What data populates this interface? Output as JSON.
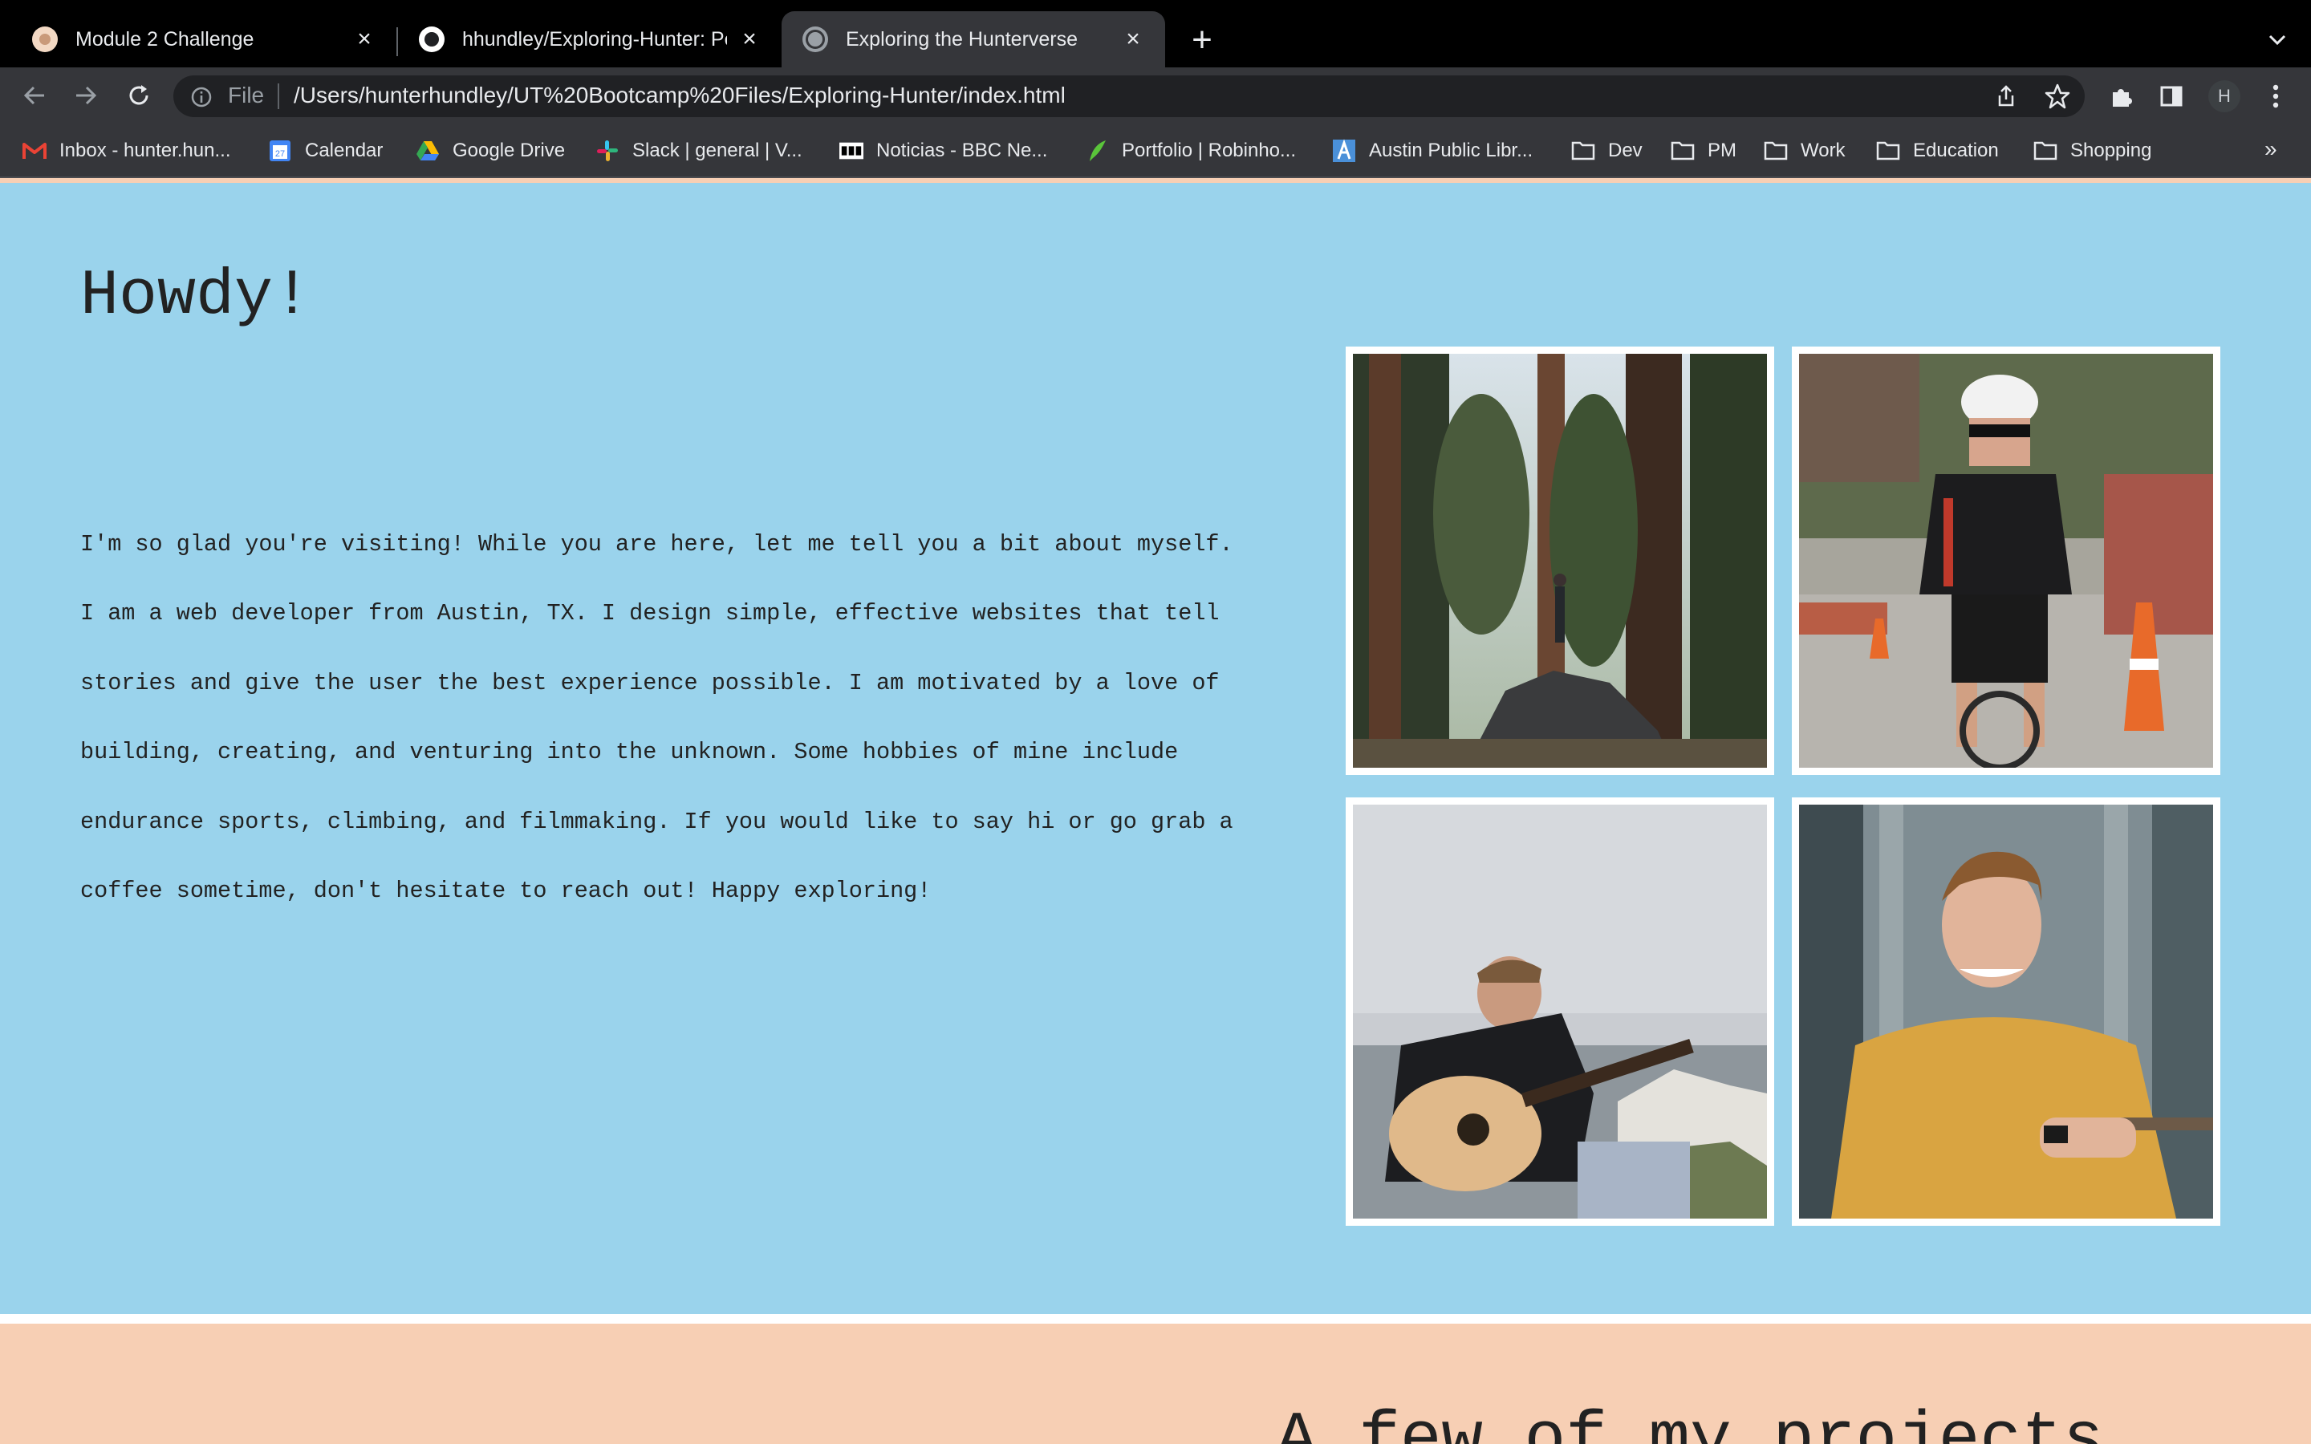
{
  "browser": {
    "tabs": [
      {
        "title": "Module 2 Challenge",
        "active": false
      },
      {
        "title": "hhundley/Exploring-Hunter: Pe",
        "active": false
      },
      {
        "title": "Exploring the Hunterverse",
        "active": true
      }
    ],
    "address": {
      "scheme_label": "File",
      "url": "/Users/hunterhundley/UT%20Bootcamp%20Files/Exploring-Hunter/index.html"
    },
    "profile_initial": "H",
    "bookmarks": [
      {
        "label": "Inbox - hunter.hun...",
        "icon": "gmail-icon"
      },
      {
        "label": "Calendar",
        "icon": "calendar-icon"
      },
      {
        "label": "Google Drive",
        "icon": "drive-icon"
      },
      {
        "label": "Slack | general | V...",
        "icon": "slack-icon"
      },
      {
        "label": "Noticias - BBC Ne...",
        "icon": "bbc-icon"
      },
      {
        "label": "Portfolio | Robinho...",
        "icon": "robinhood-icon"
      },
      {
        "label": "Austin Public Libr...",
        "icon": "library-icon"
      },
      {
        "label": "Dev",
        "icon": "folder-icon"
      },
      {
        "label": "PM",
        "icon": "folder-icon"
      },
      {
        "label": "Work",
        "icon": "folder-icon"
      },
      {
        "label": "Education",
        "icon": "folder-icon"
      },
      {
        "label": "Shopping",
        "icon": "folder-icon"
      }
    ],
    "overflow_label": "»"
  },
  "page": {
    "greeting": "Howdy!",
    "intro": "I'm so glad you're visiting! While you are here, let me tell you a bit about myself. I am a web developer from Austin, TX. I design simple, effective websites that tell stories and give the user the best experience possible. I am motivated by a love of building, creating, and venturing into the unknown. Some hobbies of mine include endurance sports, climbing, and filmmaking. If you would like to say hi or go grab a coffee sometime, don't hesitate to reach out! Happy exploring!",
    "photos": [
      "photo-forest-boulder",
      "photo-cycling-race",
      "photo-guitar-cliffs",
      "photo-portrait-yellow-shirt"
    ],
    "projects_title": "A few of my projects"
  },
  "colors": {
    "hero_bg": "#9ad3ec",
    "projects_bg": "#f7cfb4",
    "chrome_bg": "#35363a"
  }
}
